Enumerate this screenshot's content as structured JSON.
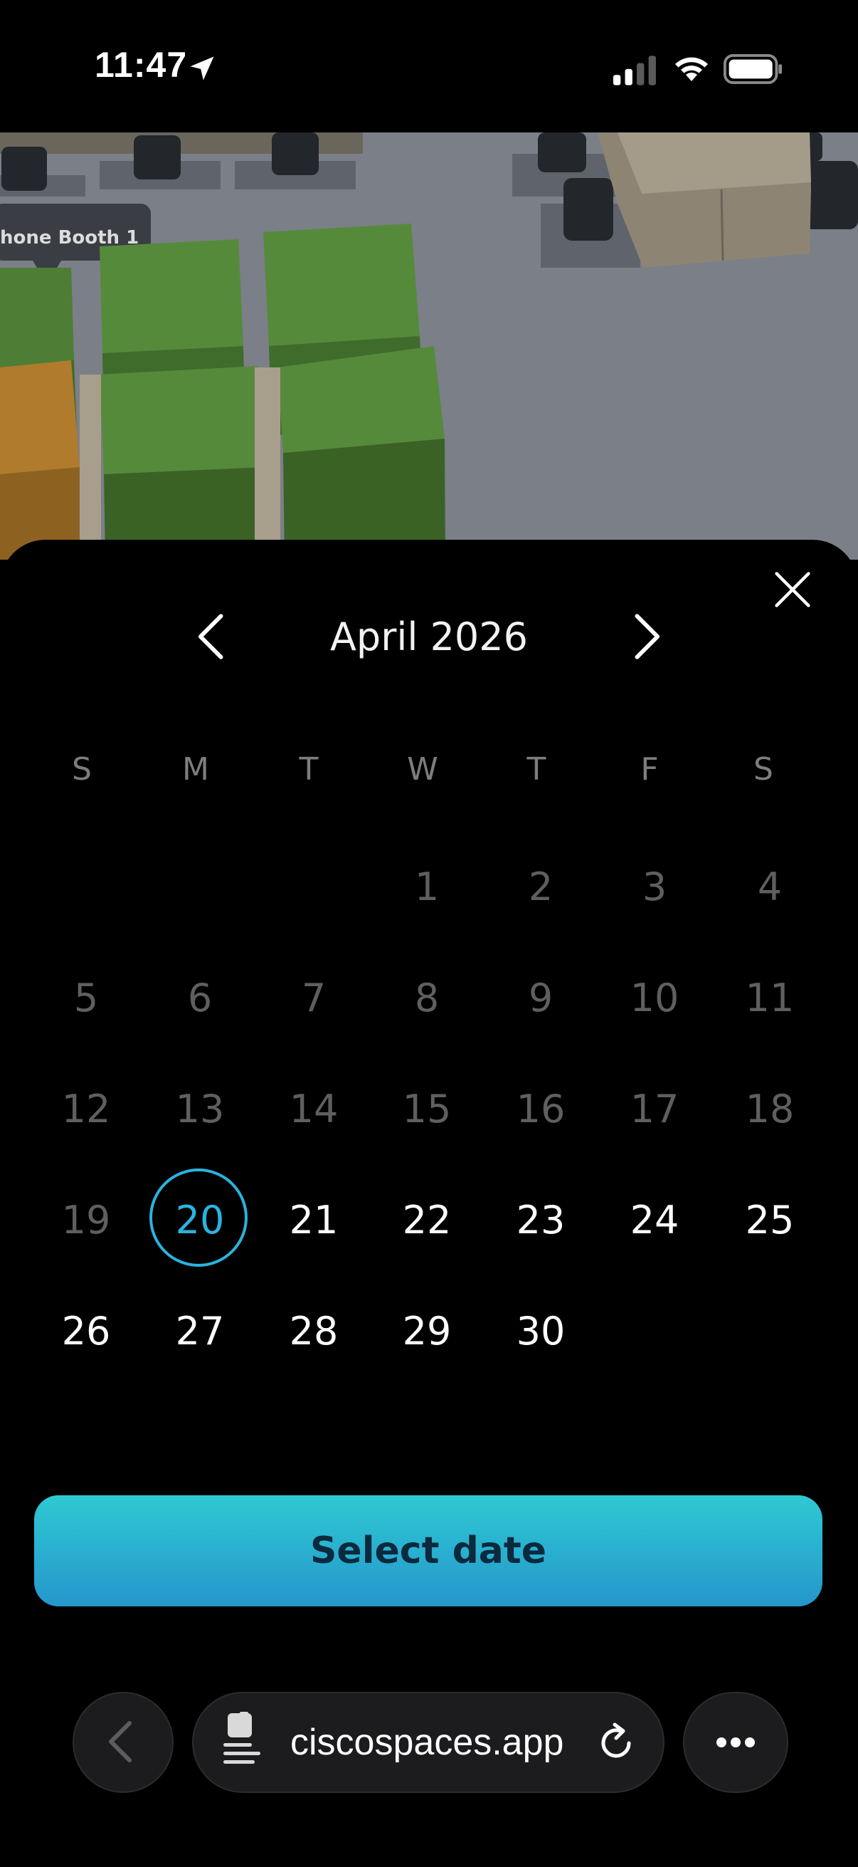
{
  "status_bar": {
    "time": "11:47",
    "icons": [
      "location-arrow-icon",
      "cellular-signal-icon",
      "wifi-icon",
      "battery-icon"
    ]
  },
  "map": {
    "label": "hone Booth 1",
    "colors": {
      "floor": "#7b7f87",
      "pod": "#4e7d35",
      "pod_orange": "#b07b2c",
      "crate": "#7c7466"
    }
  },
  "calendar": {
    "month_title": "April 2026",
    "weekdays": [
      "S",
      "M",
      "T",
      "W",
      "T",
      "F",
      "S"
    ],
    "selected_day": "20",
    "weeks": [
      [
        "",
        "",
        "",
        "1",
        "2",
        "3",
        "4"
      ],
      [
        "5",
        "6",
        "7",
        "8",
        "9",
        "10",
        "11"
      ],
      [
        "12",
        "13",
        "14",
        "15",
        "16",
        "17",
        "18"
      ],
      [
        "19",
        "20",
        "21",
        "22",
        "23",
        "24",
        "25"
      ],
      [
        "26",
        "27",
        "28",
        "29",
        "30",
        "",
        ""
      ]
    ],
    "past_until": "19",
    "colors": {
      "accent": "#2ab3de",
      "past": "#5f5f5f",
      "future": "#ffffff"
    }
  },
  "actions": {
    "select_label": "Select date"
  },
  "browser": {
    "url": "ciscospaces.app"
  }
}
